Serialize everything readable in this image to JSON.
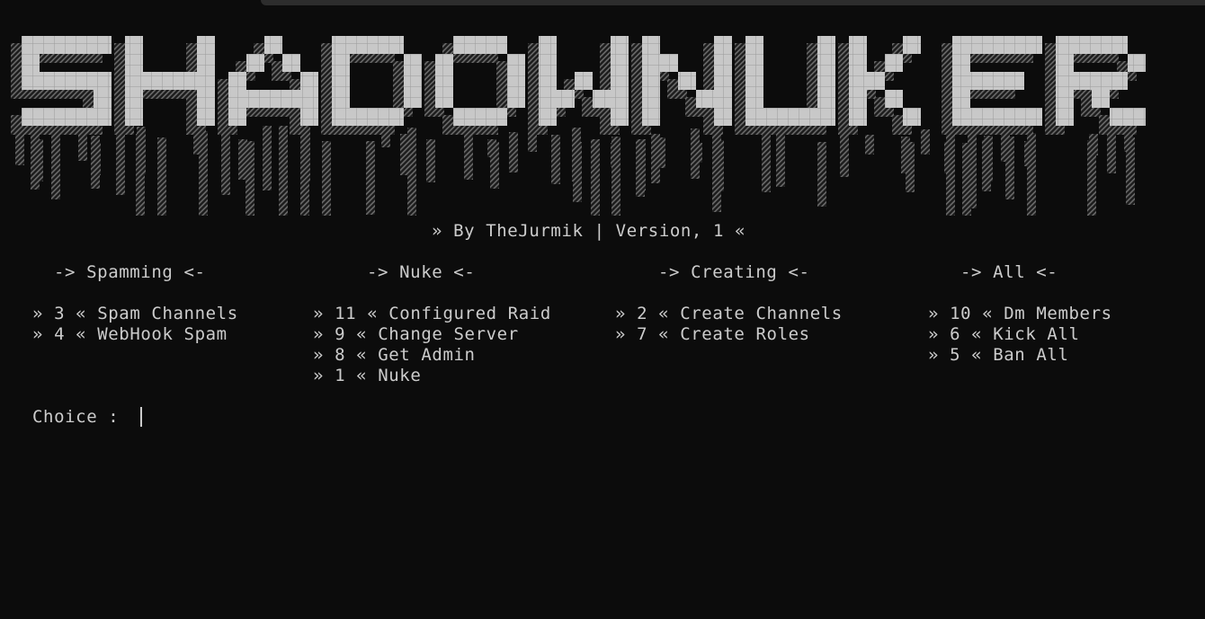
{
  "banner": {
    "text": "SHADOWNUKER"
  },
  "byline": "» By TheJurmik | Version, 1 «",
  "sections": [
    {
      "header": "-> Spamming <-",
      "items": [
        "» 3 « Spam Channels",
        "» 4 « WebHook Spam"
      ]
    },
    {
      "header": "-> Nuke <-",
      "items": [
        "» 11 « Configured Raid",
        "» 9 « Change Server",
        "» 8 « Get Admin",
        "» 1 « Nuke"
      ]
    },
    {
      "header": "-> Creating <-",
      "items": [
        "» 2 « Create Channels",
        "» 7 « Create Roles"
      ]
    },
    {
      "header": "-> All <-",
      "items": [
        "» 10 « Dm Members",
        "» 6 « Kick All",
        "» 5 « Ban All"
      ]
    }
  ],
  "prompt": "Choice :",
  "colors": {
    "background": "#0c0c0c",
    "text": "#cccccc",
    "banner_solid": "#c0c0c0",
    "banner_shade": "#4a4a4a"
  }
}
